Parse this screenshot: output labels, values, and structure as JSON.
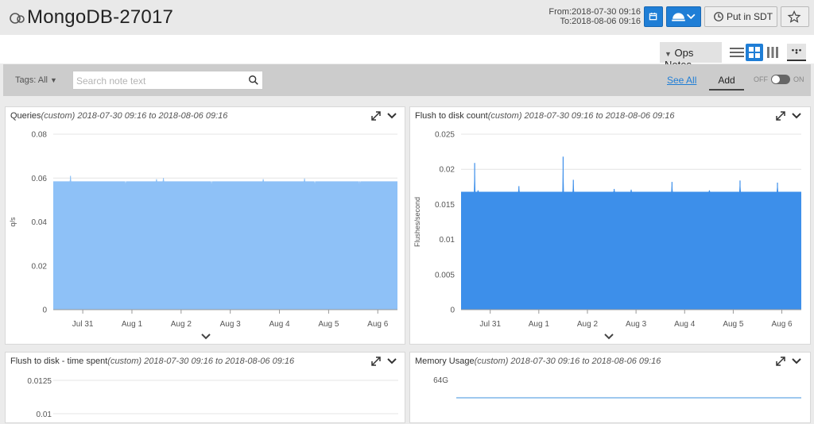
{
  "header": {
    "title": "MongoDB-27017",
    "range_from": "From:2018-07-30 09:16",
    "range_to": "To:2018-08-06 09:16",
    "sdt_label": "Put in SDT"
  },
  "toolbar": {
    "ops_notes_label": "Ops Notes"
  },
  "notes_bar": {
    "tags_label": "Tags: All",
    "search_placeholder": "Search note text",
    "see_all_label": "See All",
    "add_label": "Add",
    "toggle_off": "OFF",
    "toggle_on": "ON"
  },
  "colors": {
    "accent": "#1f7ed6",
    "queries_fill": "#8ec1f7",
    "flush_fill": "#3d8fea",
    "memory_line": "#7eb6e8"
  },
  "panels": [
    {
      "metric": "Queries",
      "range": "(custom) 2018-07-30 09:16 to 2018-08-06 09:16"
    },
    {
      "metric": "Flush to disk count",
      "range": "(custom) 2018-07-30 09:16 to 2018-08-06 09:16"
    },
    {
      "metric": "Flush to disk - time spent",
      "range": "(custom) 2018-07-30 09:16 to 2018-08-06 09:16"
    },
    {
      "metric": "Memory Usage",
      "range": "(custom) 2018-07-30 09:16 to 2018-08-06 09:16"
    }
  ],
  "chart_data": [
    {
      "type": "area",
      "title": "Queries",
      "ylabel": "q/s",
      "ylim": [
        0,
        0.08
      ],
      "yticks": [
        "0",
        "0.02",
        "0.04",
        "0.06",
        "0.08"
      ],
      "xticks": [
        "Jul 31",
        "Aug 1",
        "Aug 2",
        "Aug 3",
        "Aug 4",
        "Aug 5",
        "Aug 6"
      ],
      "baseline": 0.0585,
      "spikes": [
        {
          "x": 0.05,
          "y": 0.061
        },
        {
          "x": 0.21,
          "y": 0.0565
        },
        {
          "x": 0.3,
          "y": 0.0595
        },
        {
          "x": 0.32,
          "y": 0.06
        },
        {
          "x": 0.46,
          "y": 0.0565
        },
        {
          "x": 0.61,
          "y": 0.0595
        },
        {
          "x": 0.73,
          "y": 0.0598
        },
        {
          "x": 0.76,
          "y": 0.0565
        },
        {
          "x": 0.89,
          "y": 0.0565
        }
      ]
    },
    {
      "type": "area",
      "title": "Flush to disk count",
      "ylabel": "Flushes/second",
      "ylim": [
        0,
        0.025
      ],
      "yticks": [
        "0",
        "0.005",
        "0.01",
        "0.015",
        "0.02",
        "0.025"
      ],
      "xticks": [
        "Jul 31",
        "Aug 1",
        "Aug 2",
        "Aug 3",
        "Aug 4",
        "Aug 5",
        "Aug 6"
      ],
      "baseline": 0.0168,
      "spikes": [
        {
          "x": 0.04,
          "y": 0.0209
        },
        {
          "x": 0.05,
          "y": 0.017
        },
        {
          "x": 0.17,
          "y": 0.0176
        },
        {
          "x": 0.3,
          "y": 0.0218
        },
        {
          "x": 0.33,
          "y": 0.0185
        },
        {
          "x": 0.45,
          "y": 0.0172
        },
        {
          "x": 0.5,
          "y": 0.0171
        },
        {
          "x": 0.62,
          "y": 0.0182
        },
        {
          "x": 0.73,
          "y": 0.017
        },
        {
          "x": 0.82,
          "y": 0.0184
        },
        {
          "x": 0.93,
          "y": 0.0181
        }
      ]
    },
    {
      "type": "area",
      "title": "Flush to disk - time spent",
      "yticks": [
        "0.0125",
        "0.01"
      ]
    },
    {
      "type": "line",
      "title": "Memory Usage",
      "yticks": [
        "64G"
      ]
    }
  ]
}
